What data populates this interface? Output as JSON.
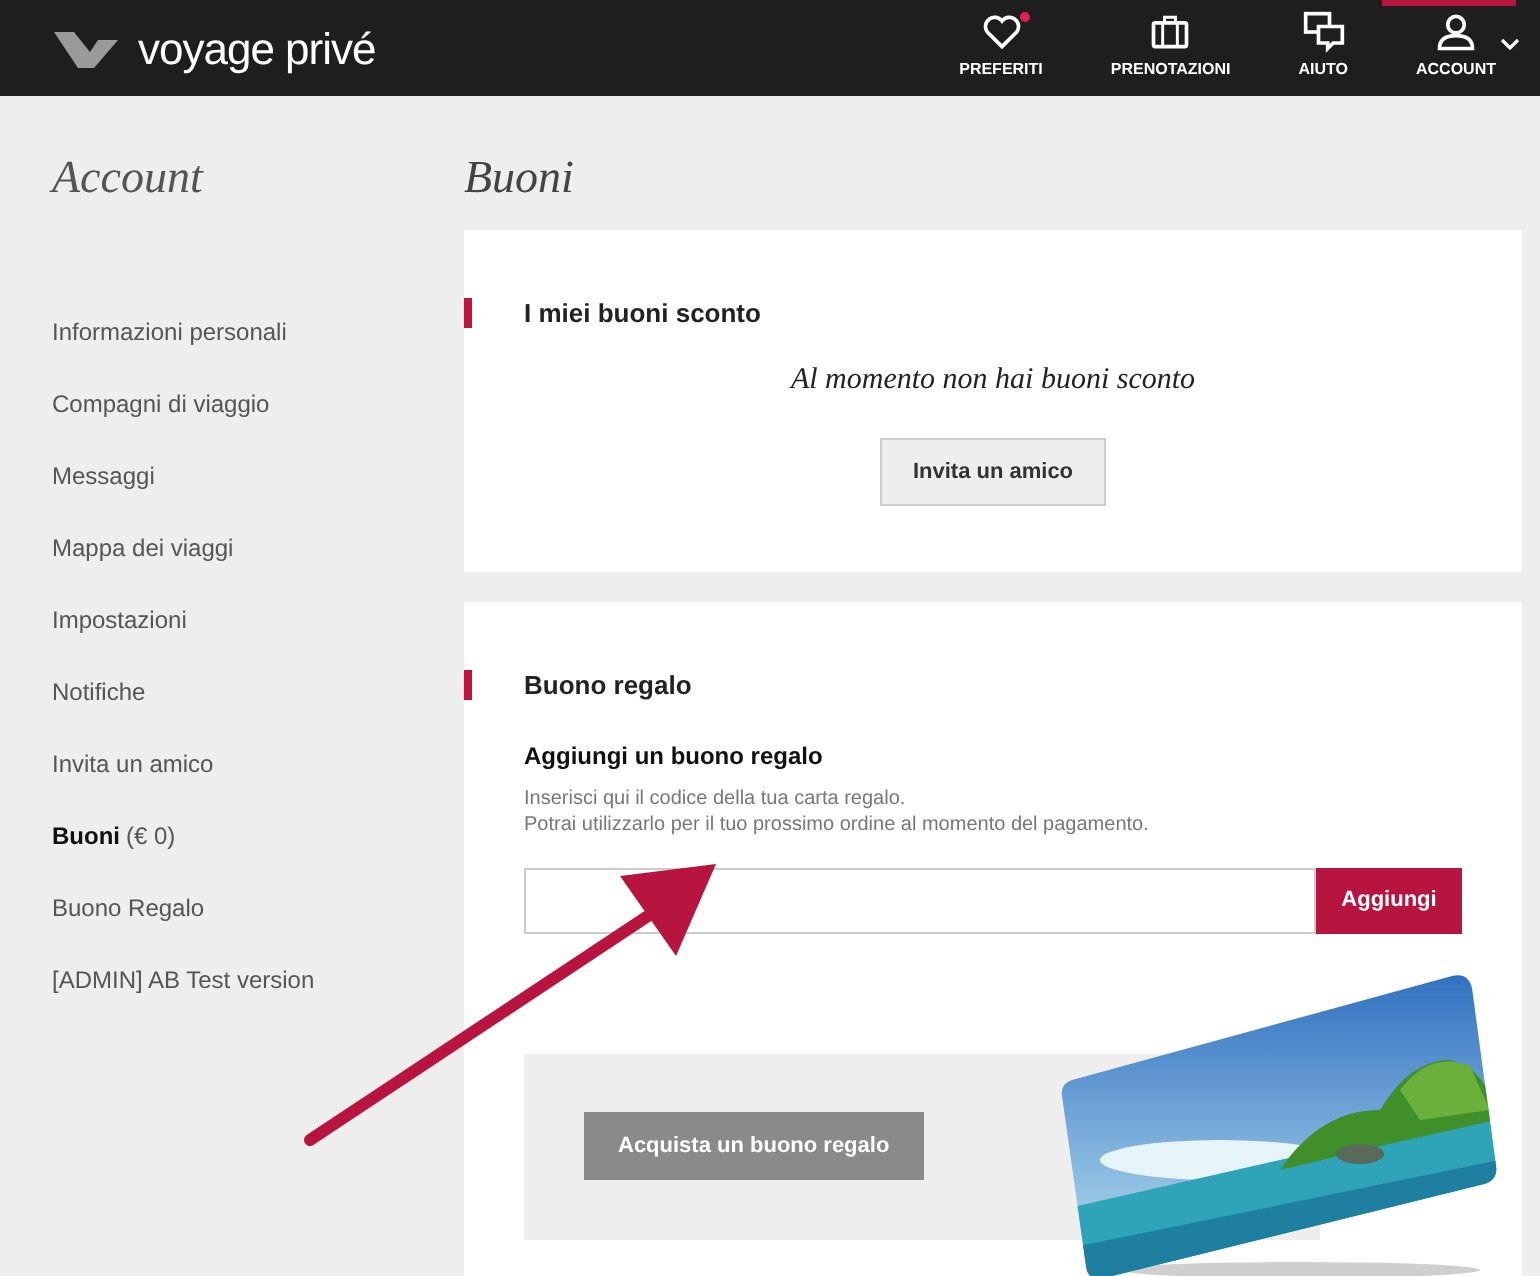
{
  "header": {
    "logo": "voyage privé",
    "nav": [
      {
        "kind": "heart",
        "label": "PREFERITI",
        "notification": true,
        "selected": false
      },
      {
        "kind": "suitcase",
        "label": "PRENOTAZIONI",
        "notification": false,
        "selected": false
      },
      {
        "kind": "chat",
        "label": "AIUTO",
        "notification": false,
        "selected": false
      },
      {
        "kind": "user",
        "label": "ACCOUNT",
        "notification": false,
        "selected": true
      }
    ]
  },
  "sidebar": {
    "title": "Account",
    "items": [
      {
        "label": "Informazioni personali",
        "selected": false
      },
      {
        "label": "Compagni di viaggio",
        "selected": false
      },
      {
        "label": "Messaggi",
        "selected": false
      },
      {
        "label": "Mappa dei viaggi",
        "selected": false
      },
      {
        "label": "Impostazioni",
        "selected": false
      },
      {
        "label": "Notifiche",
        "selected": false
      },
      {
        "label": "Invita un amico",
        "selected": false
      },
      {
        "label": "Buoni",
        "count": "(€ 0)",
        "selected": true
      },
      {
        "label": "Buono Regalo",
        "selected": false
      },
      {
        "label": "[ADMIN] AB Test version",
        "selected": false
      }
    ]
  },
  "main": {
    "title": "Buoni",
    "vouchers": {
      "heading": "I miei buoni sconto",
      "empty_message": "Al momento non hai buoni sconto",
      "button": "Invita un amico"
    },
    "gift": {
      "heading": "Buono regalo",
      "subheading": "Aggiungi un buono regalo",
      "help": [
        "Inserisci qui il codice della tua carta regalo.",
        "Potrai utilizzarlo per il tuo prossimo ordine al momento del pagamento."
      ],
      "add_button": "Aggiungi",
      "buy_button": "Acquista un buono regalo"
    }
  }
}
